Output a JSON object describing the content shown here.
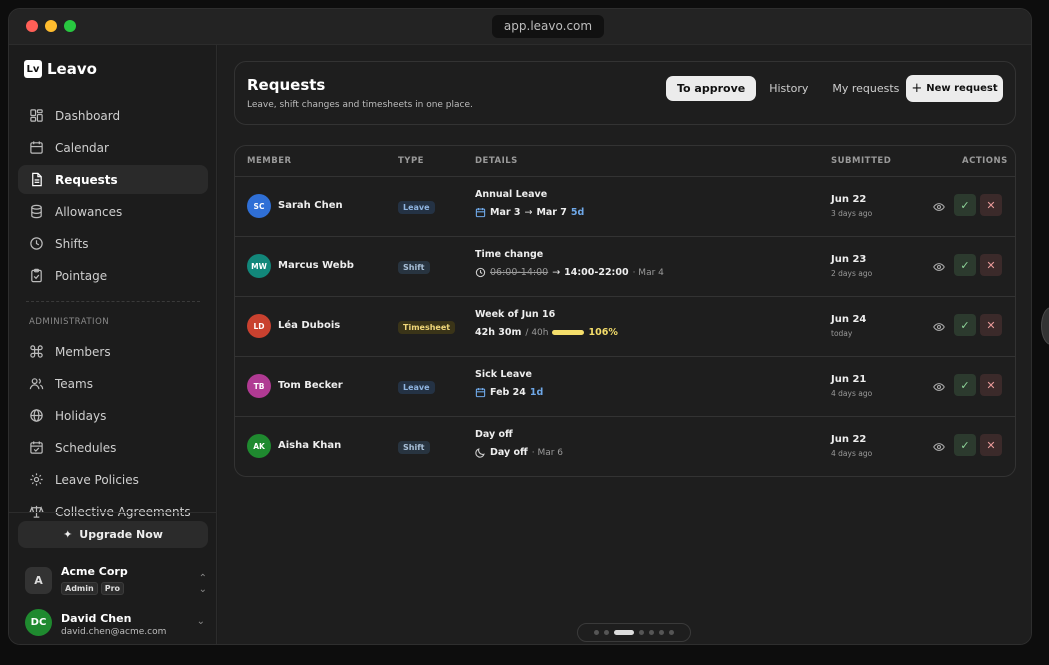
{
  "browser": {
    "url": "app.leavo.com"
  },
  "brand": {
    "logo": "Lv",
    "name": "Leavo"
  },
  "nav": {
    "items": [
      {
        "label": "Dashboard",
        "icon": "dashboard-icon"
      },
      {
        "label": "Calendar",
        "icon": "calendar-icon"
      },
      {
        "label": "Requests",
        "icon": "document-icon",
        "active": true
      },
      {
        "label": "Allowances",
        "icon": "database-icon"
      },
      {
        "label": "Shifts",
        "icon": "clock-icon"
      },
      {
        "label": "Pointage",
        "icon": "clipboard-check-icon"
      }
    ],
    "admin_section": "ADMINISTRATION",
    "admin_items": [
      {
        "label": "Members",
        "icon": "command-icon"
      },
      {
        "label": "Teams",
        "icon": "users-icon"
      },
      {
        "label": "Holidays",
        "icon": "globe-icon"
      },
      {
        "label": "Schedules",
        "icon": "calendar-check-icon"
      },
      {
        "label": "Leave Policies",
        "icon": "gear-icon"
      },
      {
        "label": "Collective Agreements",
        "icon": "scale-icon"
      }
    ]
  },
  "upgrade": {
    "label": "Upgrade Now"
  },
  "org": {
    "initial": "A",
    "name": "Acme Corp",
    "tags": [
      "Admin",
      "Pro"
    ]
  },
  "user": {
    "initials": "DC",
    "name": "David Chen",
    "email": "david.chen@acme.com"
  },
  "header": {
    "title": "Requests",
    "subtitle": "Leave, shift changes and timesheets in one place.",
    "tabs": [
      "To approve",
      "History",
      "My requests"
    ],
    "active_tab": "To approve",
    "new_button": "New request"
  },
  "table": {
    "columns": {
      "member": "MEMBER",
      "type": "TYPE",
      "details": "DETAILS",
      "submitted": "SUBMITTED",
      "actions": "ACTIONS"
    },
    "rows": [
      {
        "initials": "SC",
        "avatar_color": "#2f6fd6",
        "name": "Sarah Chen",
        "type": "Leave",
        "detail_title": "Annual Leave",
        "date_from": "Mar 3",
        "arrow": "→",
        "date_to": "Mar 7",
        "duration": "5d",
        "submitted": "Jun 22",
        "submitted_rel": "3 days ago"
      },
      {
        "initials": "MW",
        "avatar_color": "#12877a",
        "name": "Marcus Webb",
        "type": "Shift",
        "detail_title": "Time change",
        "old_time": "06:00-14:00",
        "arrow": "→",
        "new_time": "14:00-22:00",
        "date": "· Mar 4",
        "submitted": "Jun 23",
        "submitted_rel": "2 days ago"
      },
      {
        "initials": "LD",
        "avatar_color": "#c9412f",
        "name": "Léa Dubois",
        "type": "Timesheet",
        "detail_title": "Week of Jun 16",
        "hours": "42h 30m",
        "target": "/ 40h",
        "percent_label": "106%",
        "percent_value": 106,
        "submitted": "Jun 24",
        "submitted_rel": "today"
      },
      {
        "initials": "TB",
        "avatar_color": "#b03a93",
        "name": "Tom Becker",
        "type": "Leave",
        "detail_title": "Sick Leave",
        "date_from": "Feb 24",
        "duration": "1d",
        "submitted": "Jun 21",
        "submitted_rel": "4 days ago"
      },
      {
        "initials": "AK",
        "avatar_color": "#1f8a2f",
        "name": "Aisha Khan",
        "type": "Shift",
        "detail_title": "Day off",
        "dayoff_label": "Day off",
        "date": "· Mar 6",
        "submitted": "Jun 22",
        "submitted_rel": "4 days ago"
      }
    ]
  },
  "pager": {
    "count": 7,
    "active": 2
  }
}
